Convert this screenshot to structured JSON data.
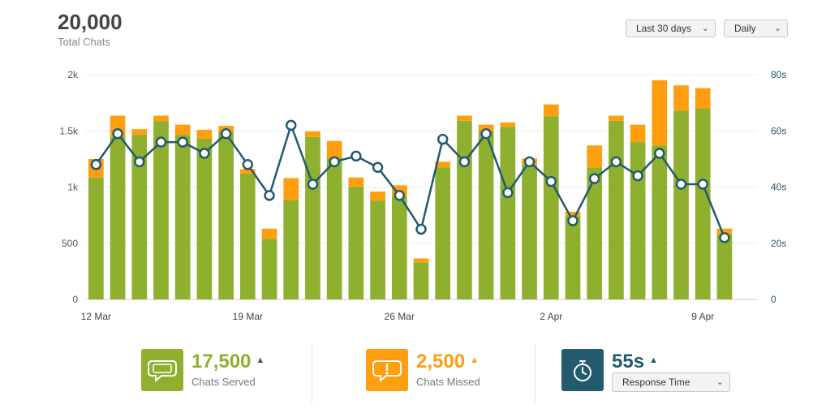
{
  "header": {
    "total_value": "20,000",
    "total_label": "Total Chats"
  },
  "controls": {
    "range_label": "Last 30 days",
    "interval_label": "Daily"
  },
  "stats": {
    "served": {
      "value": "17,500",
      "label": "Chats Served"
    },
    "missed": {
      "value": "2,500",
      "label": "Chats Missed"
    },
    "response": {
      "value": "55s",
      "select_label": "Response Time"
    }
  },
  "colors": {
    "served": "#8fb02e",
    "missed": "#ff9e0e",
    "response": "#245a6e"
  },
  "icons": {
    "served": "speech-bubble-icon",
    "missed": "alert-bubble-icon",
    "response": "stopwatch-icon",
    "trend": "triangle-up-icon",
    "dropdown": "chevron-down-icon"
  },
  "chart_data": {
    "type": "bar",
    "stacked": true,
    "x": [
      "12 Mar",
      "13 Mar",
      "14 Mar",
      "15 Mar",
      "16 Mar",
      "17 Mar",
      "18 Mar",
      "19 Mar",
      "20 Mar",
      "21 Mar",
      "22 Mar",
      "23 Mar",
      "24 Mar",
      "25 Mar",
      "26 Mar",
      "27 Mar",
      "28 Mar",
      "29 Mar",
      "30 Mar",
      "31 Mar",
      "1 Apr",
      "2 Apr",
      "3 Apr",
      "4 Apr",
      "5 Apr",
      "6 Apr",
      "7 Apr",
      "8 Apr",
      "9 Apr",
      "10 Apr",
      "11 Apr"
    ],
    "x_tick_labels": [
      "12 Mar",
      "19 Mar",
      "26 Mar",
      "2 Apr",
      "9 Apr"
    ],
    "x_tick_index": [
      0,
      7,
      14,
      21,
      28
    ],
    "series": [
      {
        "values": [
          1085,
          1450,
          1465,
          1585,
          1465,
          1430,
          1490,
          1120,
          540,
          885,
          1445,
          1260,
          1005,
          880,
          915,
          330,
          1175,
          1590,
          1500,
          1535,
          1200,
          1630,
          740,
          1175,
          1590,
          1400,
          1370,
          1680,
          1700,
          580
        ]
      },
      {
        "values": [
          165,
          185,
          50,
          50,
          90,
          80,
          55,
          40,
          90,
          195,
          50,
          150,
          80,
          80,
          100,
          35,
          50,
          45,
          55,
          40,
          55,
          105,
          40,
          195,
          45,
          155,
          580,
          225,
          180,
          50
        ]
      },
      {
        "axis": "right",
        "values": [
          48,
          59,
          49,
          56,
          56,
          52,
          59,
          48,
          37,
          62,
          41,
          49,
          51,
          47,
          37,
          25,
          57,
          49,
          59,
          38,
          49,
          42,
          28,
          43,
          49,
          44,
          52,
          41,
          41,
          22
        ]
      }
    ],
    "y_left": {
      "ticks": [
        0,
        500,
        1000,
        1500,
        2000
      ],
      "tick_labels": [
        "0",
        "500",
        "1k",
        "1.5k",
        "2k"
      ],
      "lim": [
        0,
        2000
      ]
    },
    "y_right": {
      "ticks": [
        0,
        20,
        40,
        60,
        80
      ],
      "tick_labels": [
        "0",
        "20s",
        "40s",
        "60s",
        "80s"
      ],
      "lim": [
        0,
        80
      ]
    },
    "grid": true,
    "legend": "none"
  }
}
